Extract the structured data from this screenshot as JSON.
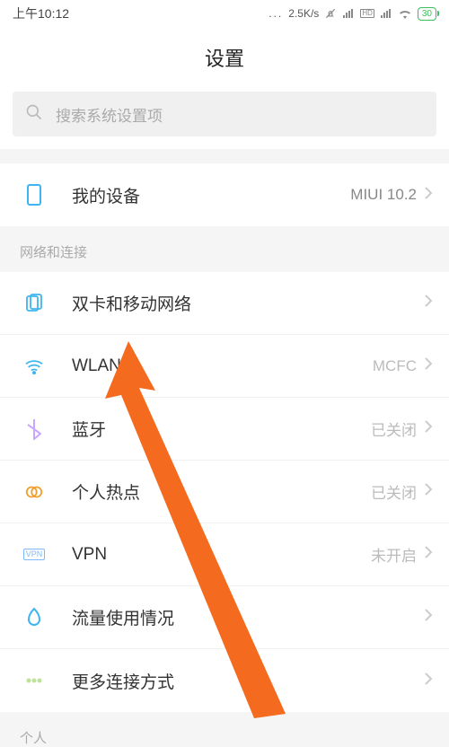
{
  "status_bar": {
    "time": "上午10:12",
    "net_speed": "2.5K/s",
    "battery_pct": "30"
  },
  "page_title": "设置",
  "search": {
    "placeholder": "搜索系统设置项"
  },
  "my_device": {
    "label": "我的设备",
    "value": "MIUI 10.2"
  },
  "section_network": {
    "header": "网络和连接",
    "items": [
      {
        "label": "双卡和移动网络",
        "value": ""
      },
      {
        "label": "WLAN",
        "value": "MCFC"
      },
      {
        "label": "蓝牙",
        "value": "已关闭"
      },
      {
        "label": "个人热点",
        "value": "已关闭"
      },
      {
        "label": "VPN",
        "value": "未开启"
      },
      {
        "label": "流量使用情况",
        "value": ""
      },
      {
        "label": "更多连接方式",
        "value": ""
      }
    ]
  },
  "section_personal_header": "个人"
}
